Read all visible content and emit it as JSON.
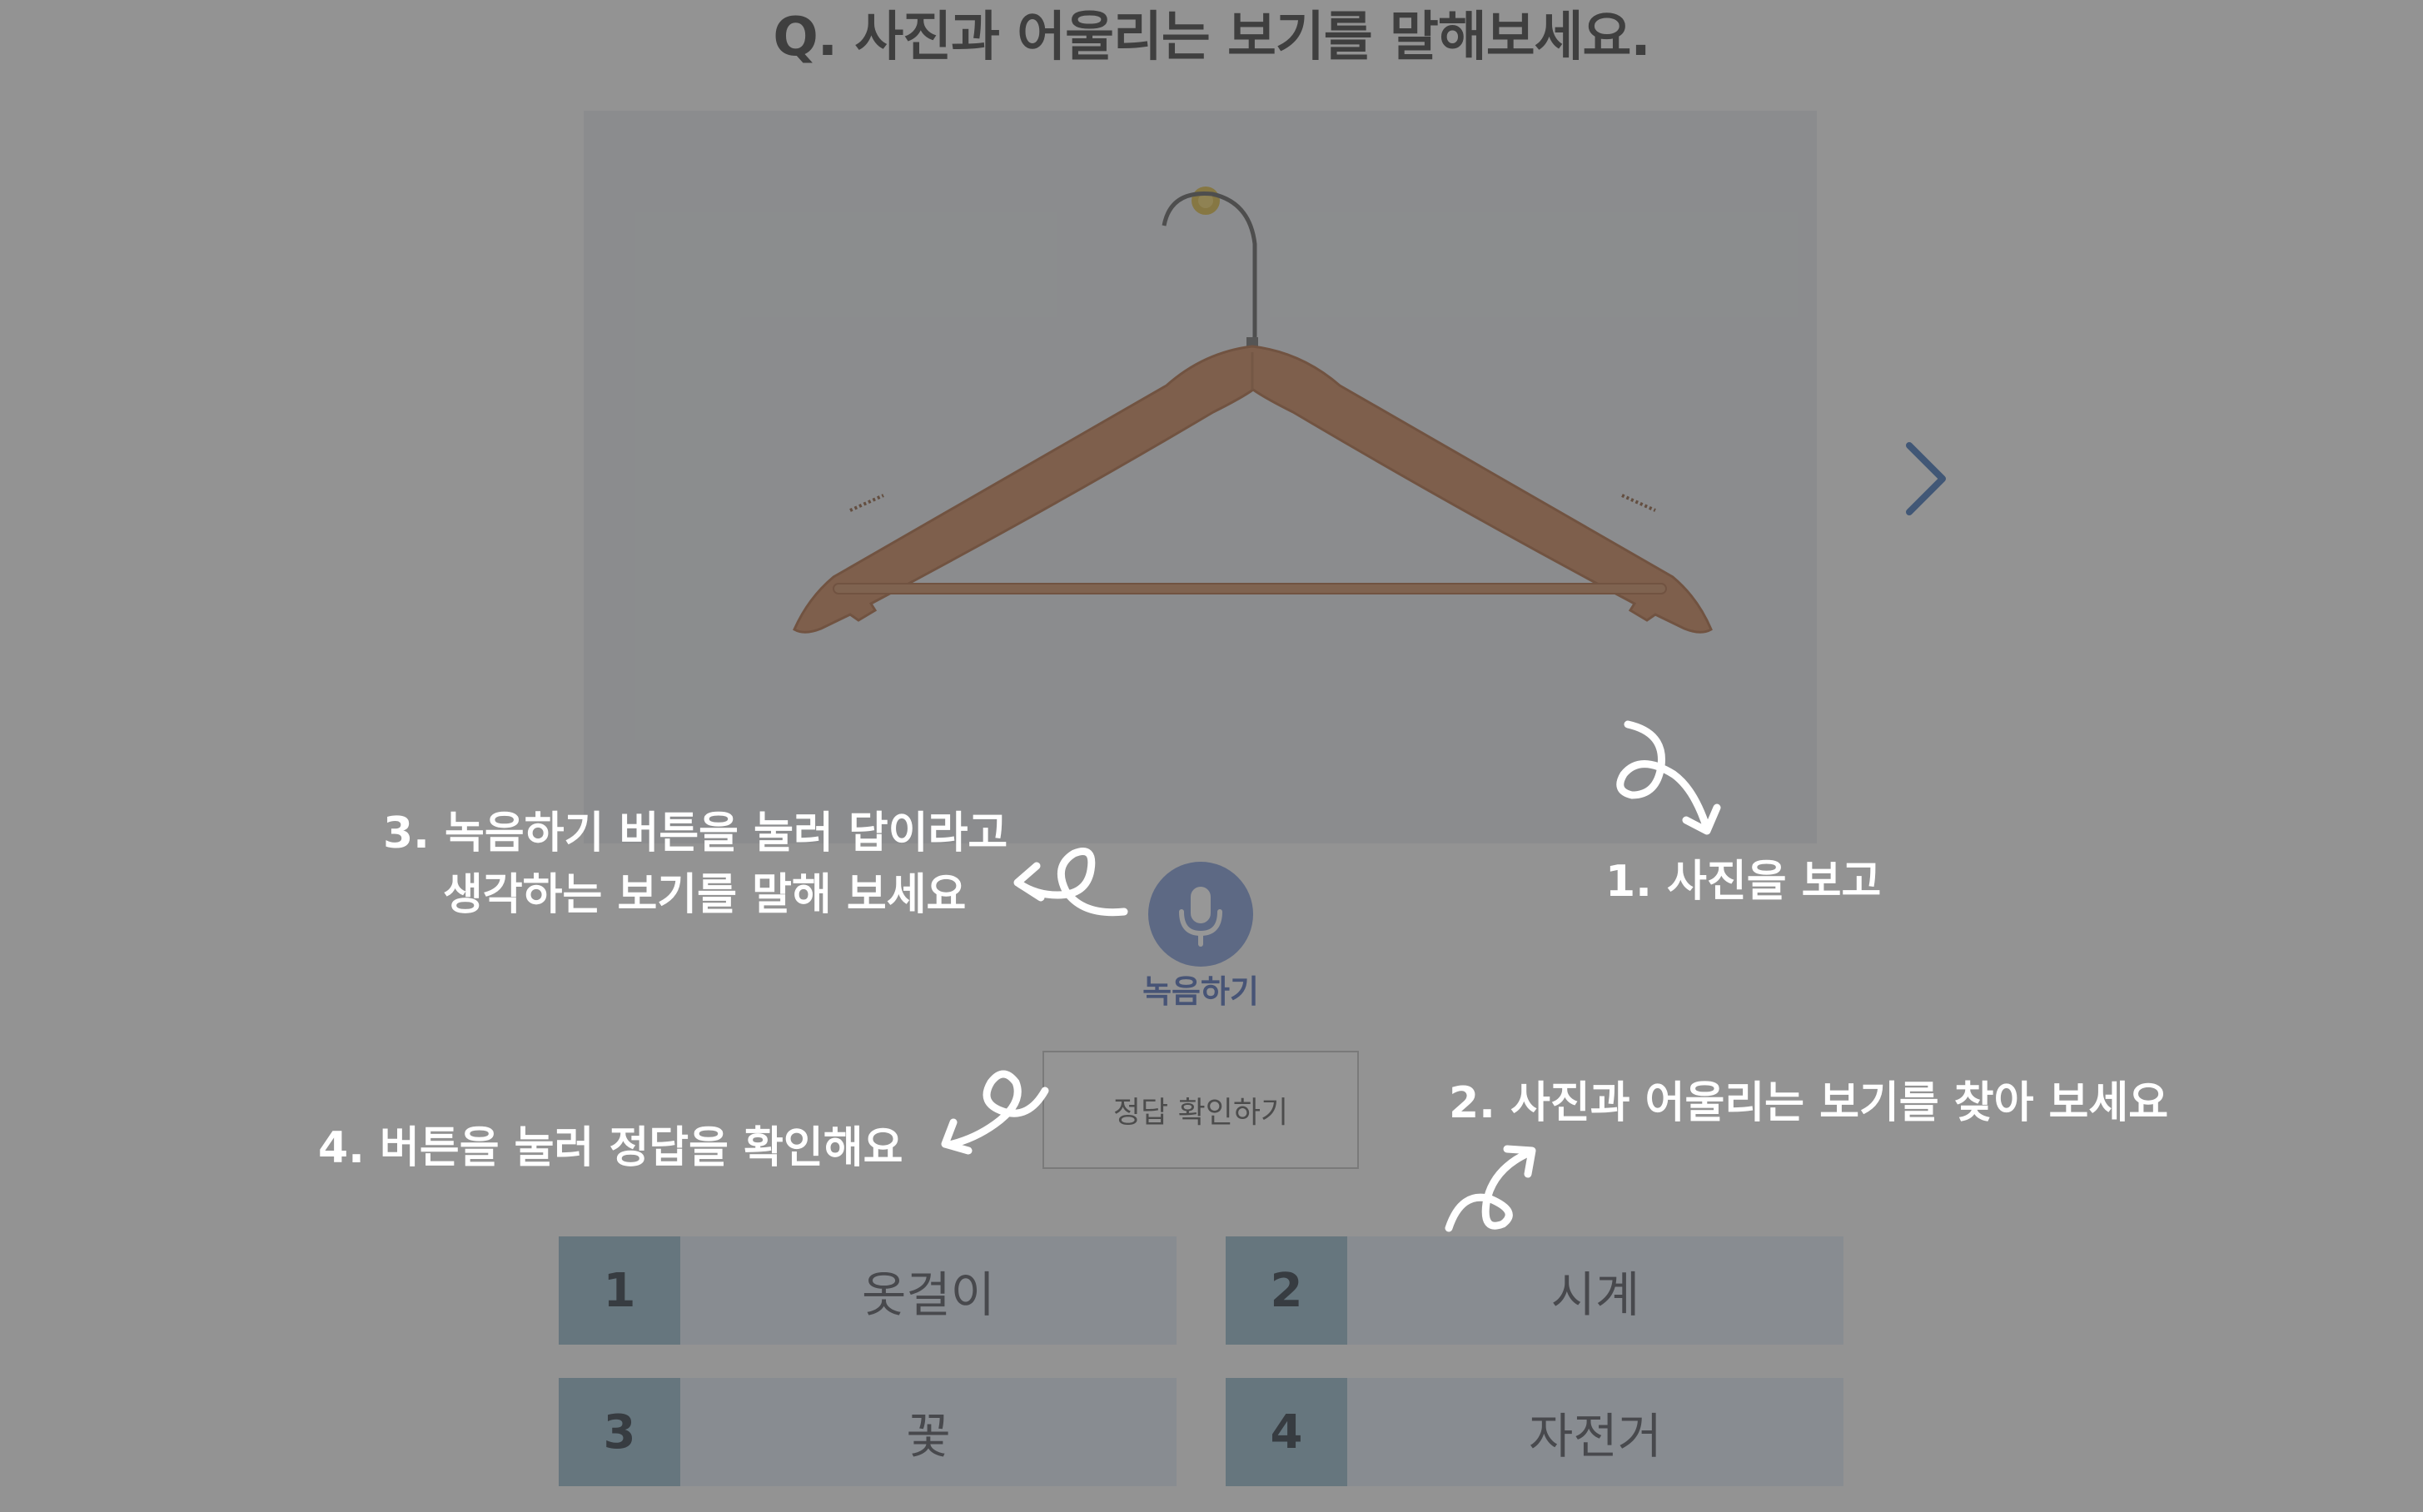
{
  "question": "Q. 사진과 어울리는 보기를 말해보세요.",
  "photo": {
    "subject": "wooden clothes hanger on wall hook"
  },
  "record": {
    "label": "녹음하기",
    "icon": "microphone-icon"
  },
  "check_answer": {
    "label": "정답 확인하기"
  },
  "next": {
    "icon": "chevron-right-icon"
  },
  "options": [
    {
      "number": "1",
      "text": "옷걸이"
    },
    {
      "number": "2",
      "text": "시계"
    },
    {
      "number": "3",
      "text": "꽃"
    },
    {
      "number": "4",
      "text": "자전거"
    }
  ],
  "annotations": {
    "step1": "1. 사진을 보고",
    "step2": "2. 사진과 어울리는 보기를 찾아 보세요",
    "step3_line1": "3. 녹음하기 버튼을 눌러 답이라고",
    "step3_line2": "생각하는 보기를 말해 보세요",
    "step4": "4. 버튼을 눌러 정답을 확인해요"
  },
  "colors": {
    "overlay": "#464646",
    "option_number_bg": "#8fb3c7",
    "option_bg": "#dce5f1",
    "record_button": "#7b96d4",
    "annotation_text": "#ffffff"
  }
}
